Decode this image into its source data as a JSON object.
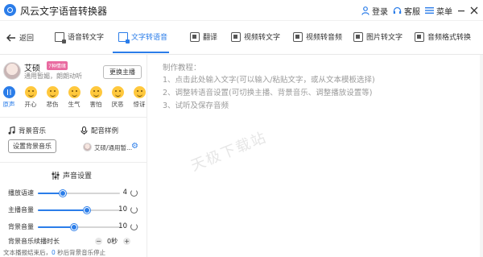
{
  "app": {
    "title": "风云文字语音转换器",
    "login": "登录",
    "service": "客服",
    "menu": "菜单"
  },
  "toolbar": {
    "back": "返回",
    "tabs": [
      {
        "label": "语音转文字",
        "icon": "speech-to-text-icon",
        "active": false
      },
      {
        "label": "文字转语音",
        "icon": "text-to-speech-icon",
        "active": true
      },
      {
        "label": "翻译",
        "icon": "translate-icon",
        "active": false
      },
      {
        "label": "视频转文字",
        "icon": "video-to-text-icon",
        "active": false
      },
      {
        "label": "视频转音频",
        "icon": "video-to-audio-icon",
        "active": false
      },
      {
        "label": "图片转文字",
        "icon": "image-to-text-icon",
        "active": false
      },
      {
        "label": "音频格式转换",
        "icon": "audio-format-icon",
        "active": false
      }
    ]
  },
  "voice": {
    "name": "艾硕",
    "badge": "7种情绪",
    "desc": "通用暂媚，朗朗动听",
    "change_button": "更换主播"
  },
  "emotions": [
    {
      "label": "原声",
      "active": true
    },
    {
      "label": "开心",
      "active": false
    },
    {
      "label": "悲伤",
      "active": false
    },
    {
      "label": "生气",
      "active": false
    },
    {
      "label": "害怕",
      "active": false
    },
    {
      "label": "厌恶",
      "active": false
    },
    {
      "label": "惊讶",
      "active": false
    }
  ],
  "background_music": {
    "title": "背景音乐",
    "button": "设置背景音乐"
  },
  "sample": {
    "title": "配音样例",
    "text": "艾硕/通用暂..."
  },
  "sound_settings": {
    "title": "声音设置",
    "rows": [
      {
        "label": "播放语速",
        "value": "4",
        "level": 0.3
      },
      {
        "label": "主播音量",
        "value": "10",
        "level": 0.6
      },
      {
        "label": "背景音量",
        "value": "10",
        "level": 0.44
      }
    ],
    "duration": {
      "label": "背景音乐续播时长",
      "value": "0秒",
      "minus": "−",
      "plus": "+"
    },
    "note_prefix": "文本播报结束后，",
    "note_num": "0",
    "note_suffix": " 秒后背景音乐停止"
  },
  "tutorial": {
    "title": "制作教程：",
    "steps": [
      "1、点击此处输入文字(可以输入/粘贴文字，或从文本模板选择)",
      "2、调整转语音设置(可切换主播、背景音乐、调整播放设置等)",
      "3、试听及保存音频"
    ]
  },
  "watermark": "天极下载站",
  "colors": {
    "accent": "#2b7de9",
    "badge": "#e96aa0",
    "emoji": "#ffc83d"
  }
}
